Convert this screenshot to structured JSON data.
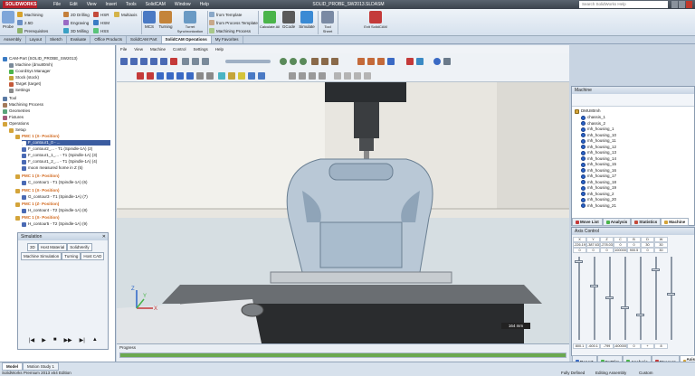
{
  "app": {
    "brand": "SOLIDWORKS",
    "title": "SOLID_PROBE_SW2013.SLDASM",
    "menu": [
      "File",
      "Edit",
      "View",
      "Insert",
      "Tools",
      "SolidCAM",
      "Window",
      "Help"
    ],
    "search_placeholder": "Search SolidWorks Help"
  },
  "ribbon": {
    "probe": "Probe",
    "col1": [
      "Machining",
      "2.5D",
      "Prerequisites"
    ],
    "col2": [
      "2D Drilling",
      "Engraving",
      "3D Milling"
    ],
    "col3": [
      "HSR",
      "HSM",
      "HSS"
    ],
    "col4": [
      "Multiaxis"
    ],
    "mcs": "MCS",
    "turning": "Turning",
    "turret": "Turret Synchronization",
    "col5": [
      "from Template",
      "from Process Template",
      "Machining Process"
    ],
    "calculate": "Calculate All",
    "gcode": "GCode",
    "simulate": "Simulate",
    "toolsheet": "Tool Sheet",
    "exit": "Exit SolidCAM"
  },
  "tabs": [
    "Assembly",
    "Layout",
    "Sketch",
    "Evaluate",
    "Office Products",
    "SolidCAM Part",
    "SolidCAM Operations",
    "My Favorites"
  ],
  "tree": {
    "items": [
      "CAM-Part (SOLID_PROBE_SW2013)",
      "Machine (dmu80mh)",
      "CoordSys Manager",
      "Stock (stock)",
      "Target (target)",
      "Settings",
      "Tool",
      "Machining Process",
      "Geometries",
      "Fixtures",
      "Operations",
      "Setup",
      "PMC 1 (X- Position)",
      "F_contour1_0 - ...",
      "F_contour2_... - T1 (Spindle-1A) (2)",
      "F_contour1_1_... - T1 (Spindle-1A) (3)",
      "F_contour1_2_... - T1 (Spindle-1A) (4)",
      "moon measured home in Z (5)",
      "PMC 1 (X- Position)",
      "C_contour1 - T1 (Spindle-1A) (6)",
      "PMC 1 (X- Position)",
      "G_contour3 - T1 (Spindle-1A) (7)",
      "PMC 1 (Z- Position)",
      "H_contour4 - T2 (Spindle-1A) (8)",
      "PMC 1 (X- Position)",
      "H_contour5 - T2 (Spindle-1A) (9)"
    ]
  },
  "simulation": {
    "title": "Simulation",
    "row1": [
      "3D",
      "Host Material",
      "SolidVerify"
    ],
    "row2": [
      "Machine Simulation",
      "Turning",
      "Host CAD"
    ],
    "controls": [
      "|◀",
      "▶",
      "■",
      "▶▶",
      "▶|",
      "▲"
    ]
  },
  "viewport": {
    "menu": [
      "File",
      "View",
      "Machine",
      "Control",
      "Settings",
      "Help"
    ],
    "scale": "164 mm"
  },
  "progress": {
    "label": "Progress",
    "value": 1.0
  },
  "machine_panel": {
    "title": "Machine",
    "root": "DMU80mh",
    "items": [
      "chassis_1",
      "chassis_2",
      "mh_housing_1",
      "mh_housing_10",
      "mh_housing_11",
      "mh_housing_12",
      "mh_housing_13",
      "mh_housing_14",
      "mh_housing_15",
      "mh_housing_16",
      "mh_housing_17",
      "mh_housing_18",
      "mh_housing_19",
      "mh_housing_2",
      "mh_housing_20",
      "mh_housing_21"
    ],
    "tabs": [
      "Move List",
      "Analysis",
      "Statistics",
      "Machine"
    ]
  },
  "axis_control": {
    "title": "Axis Control",
    "headers": [
      "X",
      "Y",
      "Z",
      "C",
      "B",
      "D",
      "W"
    ],
    "row1": [
      "-226.191",
      "-387.631",
      "-278.034",
      "0",
      "0",
      "30",
      "30"
    ],
    "row2": [
      "0",
      "0",
      "0",
      "100000",
      "900.5",
      "0",
      "30"
    ],
    "row3": [
      "800.1",
      "-600.1",
      "-799",
      "-600000",
      "0",
      "+",
      "8"
    ],
    "slider_levels": [
      0.05,
      0.35,
      0.5,
      0.62,
      0.72,
      0.15,
      0.45
    ],
    "bottom_tabs": [
      "Report",
      "CutSim",
      "Analysis",
      "Measure",
      "Axis C..."
    ]
  },
  "status": {
    "tabs": [
      "Model",
      "Motion Study 1"
    ],
    "line": "SolidWorks Premium 2013 x64 Edition",
    "right": [
      "Fully Defined",
      "Editing Assembly",
      "Custom"
    ]
  },
  "colors": {
    "accent": "#2a64c8",
    "orange": "#d2691e",
    "selection": "#3b5ca0"
  }
}
